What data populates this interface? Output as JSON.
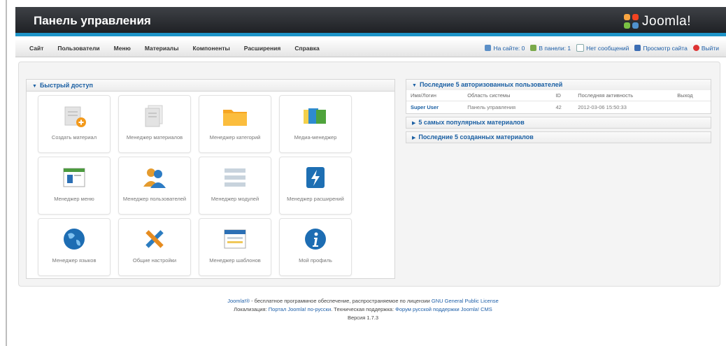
{
  "header": {
    "title": "Панель управления",
    "logo_text": "Joomla!"
  },
  "menu": [
    "Сайт",
    "Пользователи",
    "Меню",
    "Материалы",
    "Компоненты",
    "Расширения",
    "Справка"
  ],
  "status": {
    "on_site": "На сайте: 0",
    "in_panel": "В панели: 1",
    "messages": "Нет сообщений",
    "view_site": "Просмотр сайта",
    "logout": "Выйти"
  },
  "quick_access": {
    "title": "Быстрый доступ",
    "tiles": [
      {
        "label": "Создать материал",
        "icon": "new-article-icon"
      },
      {
        "label": "Менеджер материалов",
        "icon": "articles-icon"
      },
      {
        "label": "Менеджер категорий",
        "icon": "folder-icon"
      },
      {
        "label": "Медиа-менеджер",
        "icon": "media-icon"
      },
      {
        "label": "Менеджер меню",
        "icon": "menu-manager-icon"
      },
      {
        "label": "Менеджер пользователей",
        "icon": "users-icon"
      },
      {
        "label": "Менеджер модулей",
        "icon": "modules-icon"
      },
      {
        "label": "Менеджер расширений",
        "icon": "extensions-icon"
      },
      {
        "label": "Менеджер языков",
        "icon": "globe-icon"
      },
      {
        "label": "Общие настройки",
        "icon": "tools-icon"
      },
      {
        "label": "Менеджер шаблонов",
        "icon": "templates-icon"
      },
      {
        "label": "Мой профиль",
        "icon": "info-icon"
      }
    ]
  },
  "logged_users": {
    "title": "Последние 5 авторизованных пользователей",
    "columns": [
      "Имя/Логин",
      "Область системы",
      "ID",
      "Последняя активность",
      "Выход"
    ],
    "rows": [
      {
        "name": "Super User",
        "area": "Панель управления",
        "id": "42",
        "last": "2012-03-06 15:50:33",
        "logout": ""
      }
    ]
  },
  "popular": {
    "title": "5 самых популярных материалов"
  },
  "recent": {
    "title": "Последние 5 созданных материалов"
  },
  "footer": {
    "line1_link": "Joomla!®",
    "line1_text": " - бесплатное программное обеспечение, распространяемое по лицензии ",
    "line1_license": "GNU General Public License",
    "line2_label": "Локализация: ",
    "line2_link1": "Портал Joomla! по-русски",
    "line2_mid": ". Техническая поддержка: ",
    "line2_link2": "Форум русской поддержки Joomla! CMS",
    "version": "Версия 1.7.3"
  },
  "colors": {
    "accent": "#1e94c8",
    "header": "#2a2c30",
    "link": "#1a5fa3"
  }
}
